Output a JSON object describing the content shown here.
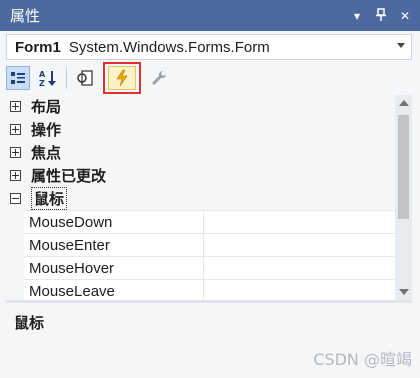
{
  "window": {
    "title": "属性"
  },
  "title_controls": [
    {
      "icon": "dropdown-arrow-icon",
      "glyph": "▾"
    },
    {
      "icon": "pin-icon",
      "glyph": "⊥"
    },
    {
      "icon": "close-icon",
      "glyph": "✕"
    }
  ],
  "object_selector": {
    "name": "Form1",
    "type": "System.Windows.Forms.Form"
  },
  "toolbar": {
    "buttons": [
      {
        "icon": "categorized-icon",
        "active": true
      },
      {
        "icon": "alphabetical-sort-icon",
        "active": false
      },
      {
        "icon": "properties-page-icon",
        "active": false
      },
      {
        "icon": "events-lightning-icon",
        "active": true,
        "highlighted": true
      },
      {
        "icon": "wrench-icon",
        "active": false
      }
    ]
  },
  "grid": {
    "categories": [
      {
        "label": "布局",
        "expanded": false
      },
      {
        "label": "操作",
        "expanded": false
      },
      {
        "label": "焦点",
        "expanded": false
      },
      {
        "label": "属性已更改",
        "expanded": false
      },
      {
        "label": "鼠标",
        "expanded": true,
        "selected": true
      }
    ],
    "events": [
      {
        "name": "MouseDown",
        "value": ""
      },
      {
        "name": "MouseEnter",
        "value": ""
      },
      {
        "name": "MouseHover",
        "value": ""
      },
      {
        "name": "MouseLeave",
        "value": ""
      }
    ]
  },
  "description": {
    "title": "鼠标"
  },
  "watermark": "CSDN @暄竭",
  "colors": {
    "titlebar": "#4b6aa0",
    "highlight_border": "#e03030",
    "accent_yellow": "#f2a900"
  }
}
